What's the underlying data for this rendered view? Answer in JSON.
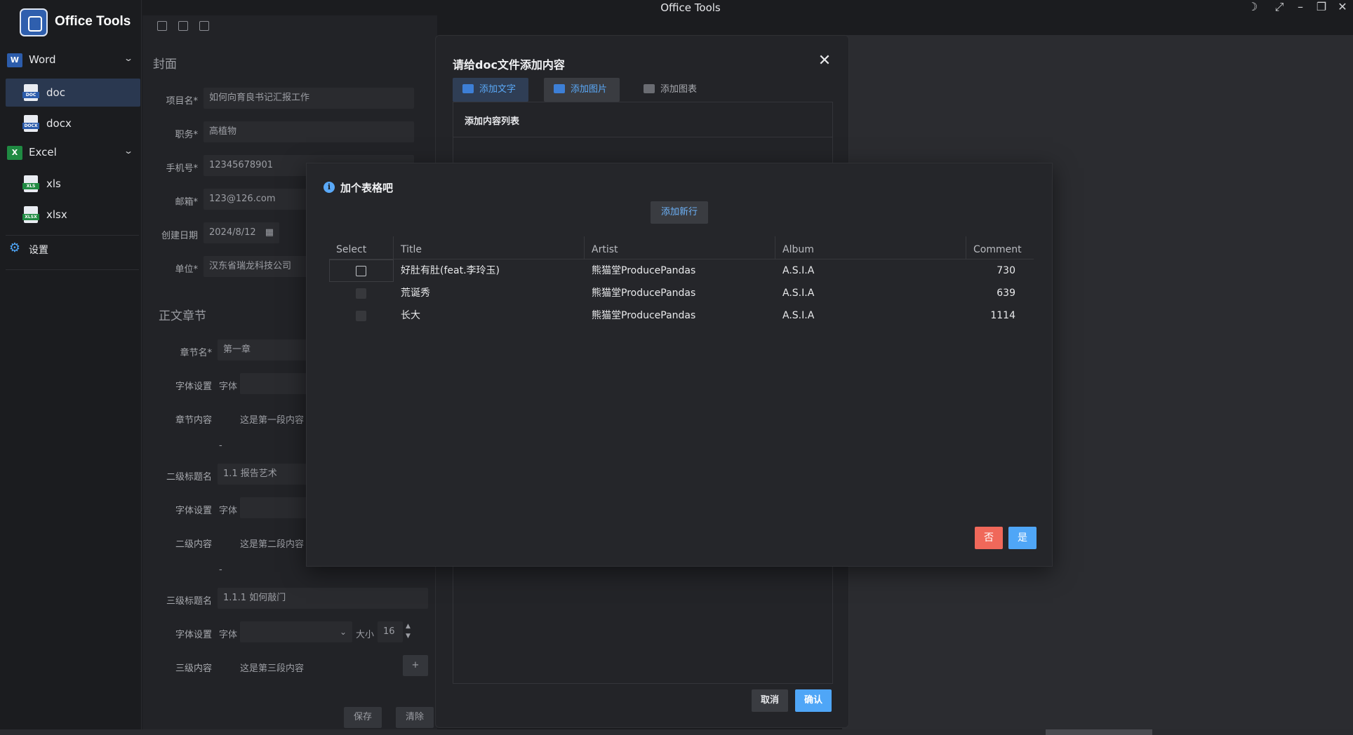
{
  "window": {
    "title": "Office Tools"
  },
  "sidebar": {
    "brand": "Office Tools",
    "groups": [
      {
        "label": "Word",
        "icon": "word-icon",
        "items": [
          "doc",
          "docx"
        ]
      },
      {
        "label": "Excel",
        "icon": "excel-icon",
        "items": [
          "xls",
          "xlsx"
        ]
      }
    ],
    "settings_label": "设置",
    "active_item": "doc"
  },
  "form": {
    "cover_title": "封面",
    "fields": [
      {
        "label": "项目名*",
        "value": "如何向育良书记汇报工作"
      },
      {
        "label": "职务*",
        "value": "高植物"
      },
      {
        "label": "手机号*",
        "value": "12345678901"
      },
      {
        "label": "邮箱*",
        "value": "123@126.com"
      },
      {
        "label": "创建日期",
        "value": "2024/8/12"
      },
      {
        "label": "单位*",
        "value": "汉东省瑞龙科技公司"
      }
    ],
    "body_title": "正文章节",
    "chapter": [
      {
        "label": "章节名*",
        "value": "第一章"
      },
      {
        "label": "字体设置",
        "value": "字体"
      },
      {
        "label": "章节内容",
        "value": "这是第一段内容"
      },
      {
        "label": "二级标题名",
        "value": "1.1 报告艺术"
      },
      {
        "label": "字体设置",
        "value": "字体"
      },
      {
        "label": "二级内容",
        "value": "这是第二段内容"
      },
      {
        "label": "三级标题名",
        "value": "1.1.1 如何敲门"
      },
      {
        "label": "字体设置",
        "value": "字体"
      },
      {
        "label": "三级内容",
        "value": "这是第三段内容"
      }
    ],
    "dash": "-",
    "size_label": "大小",
    "size_value": "16",
    "plus_label": "+",
    "save_label": "保存",
    "clear_label": "清除"
  },
  "doc_dialog": {
    "title": "请给doc文件添加内容",
    "tabs": [
      "添加文字",
      "添加图片",
      "添加图表"
    ],
    "list_title": "添加内容列表",
    "cancel_label": "取消",
    "confirm_label": "确认"
  },
  "table_modal": {
    "title": "加个表格吧",
    "info_glyph": "i",
    "add_row_label": "添加新行",
    "columns": [
      "Select",
      "Title",
      "Artist",
      "Album",
      "Comment"
    ],
    "rows": [
      {
        "title": "好肚有肚(feat.李玲玉)",
        "artist": "熊猫堂ProducePandas",
        "album": "A.S.I.A",
        "comment": "730"
      },
      {
        "title": "荒诞秀",
        "artist": "熊猫堂ProducePandas",
        "album": "A.S.I.A",
        "comment": "639"
      },
      {
        "title": "长大",
        "artist": "熊猫堂ProducePandas",
        "album": "A.S.I.A",
        "comment": "1114"
      }
    ],
    "no_label": "否",
    "yes_label": "是"
  },
  "colors": {
    "accent": "#4fa6f7",
    "danger": "#f0685a",
    "background": "#1b1c1f"
  }
}
